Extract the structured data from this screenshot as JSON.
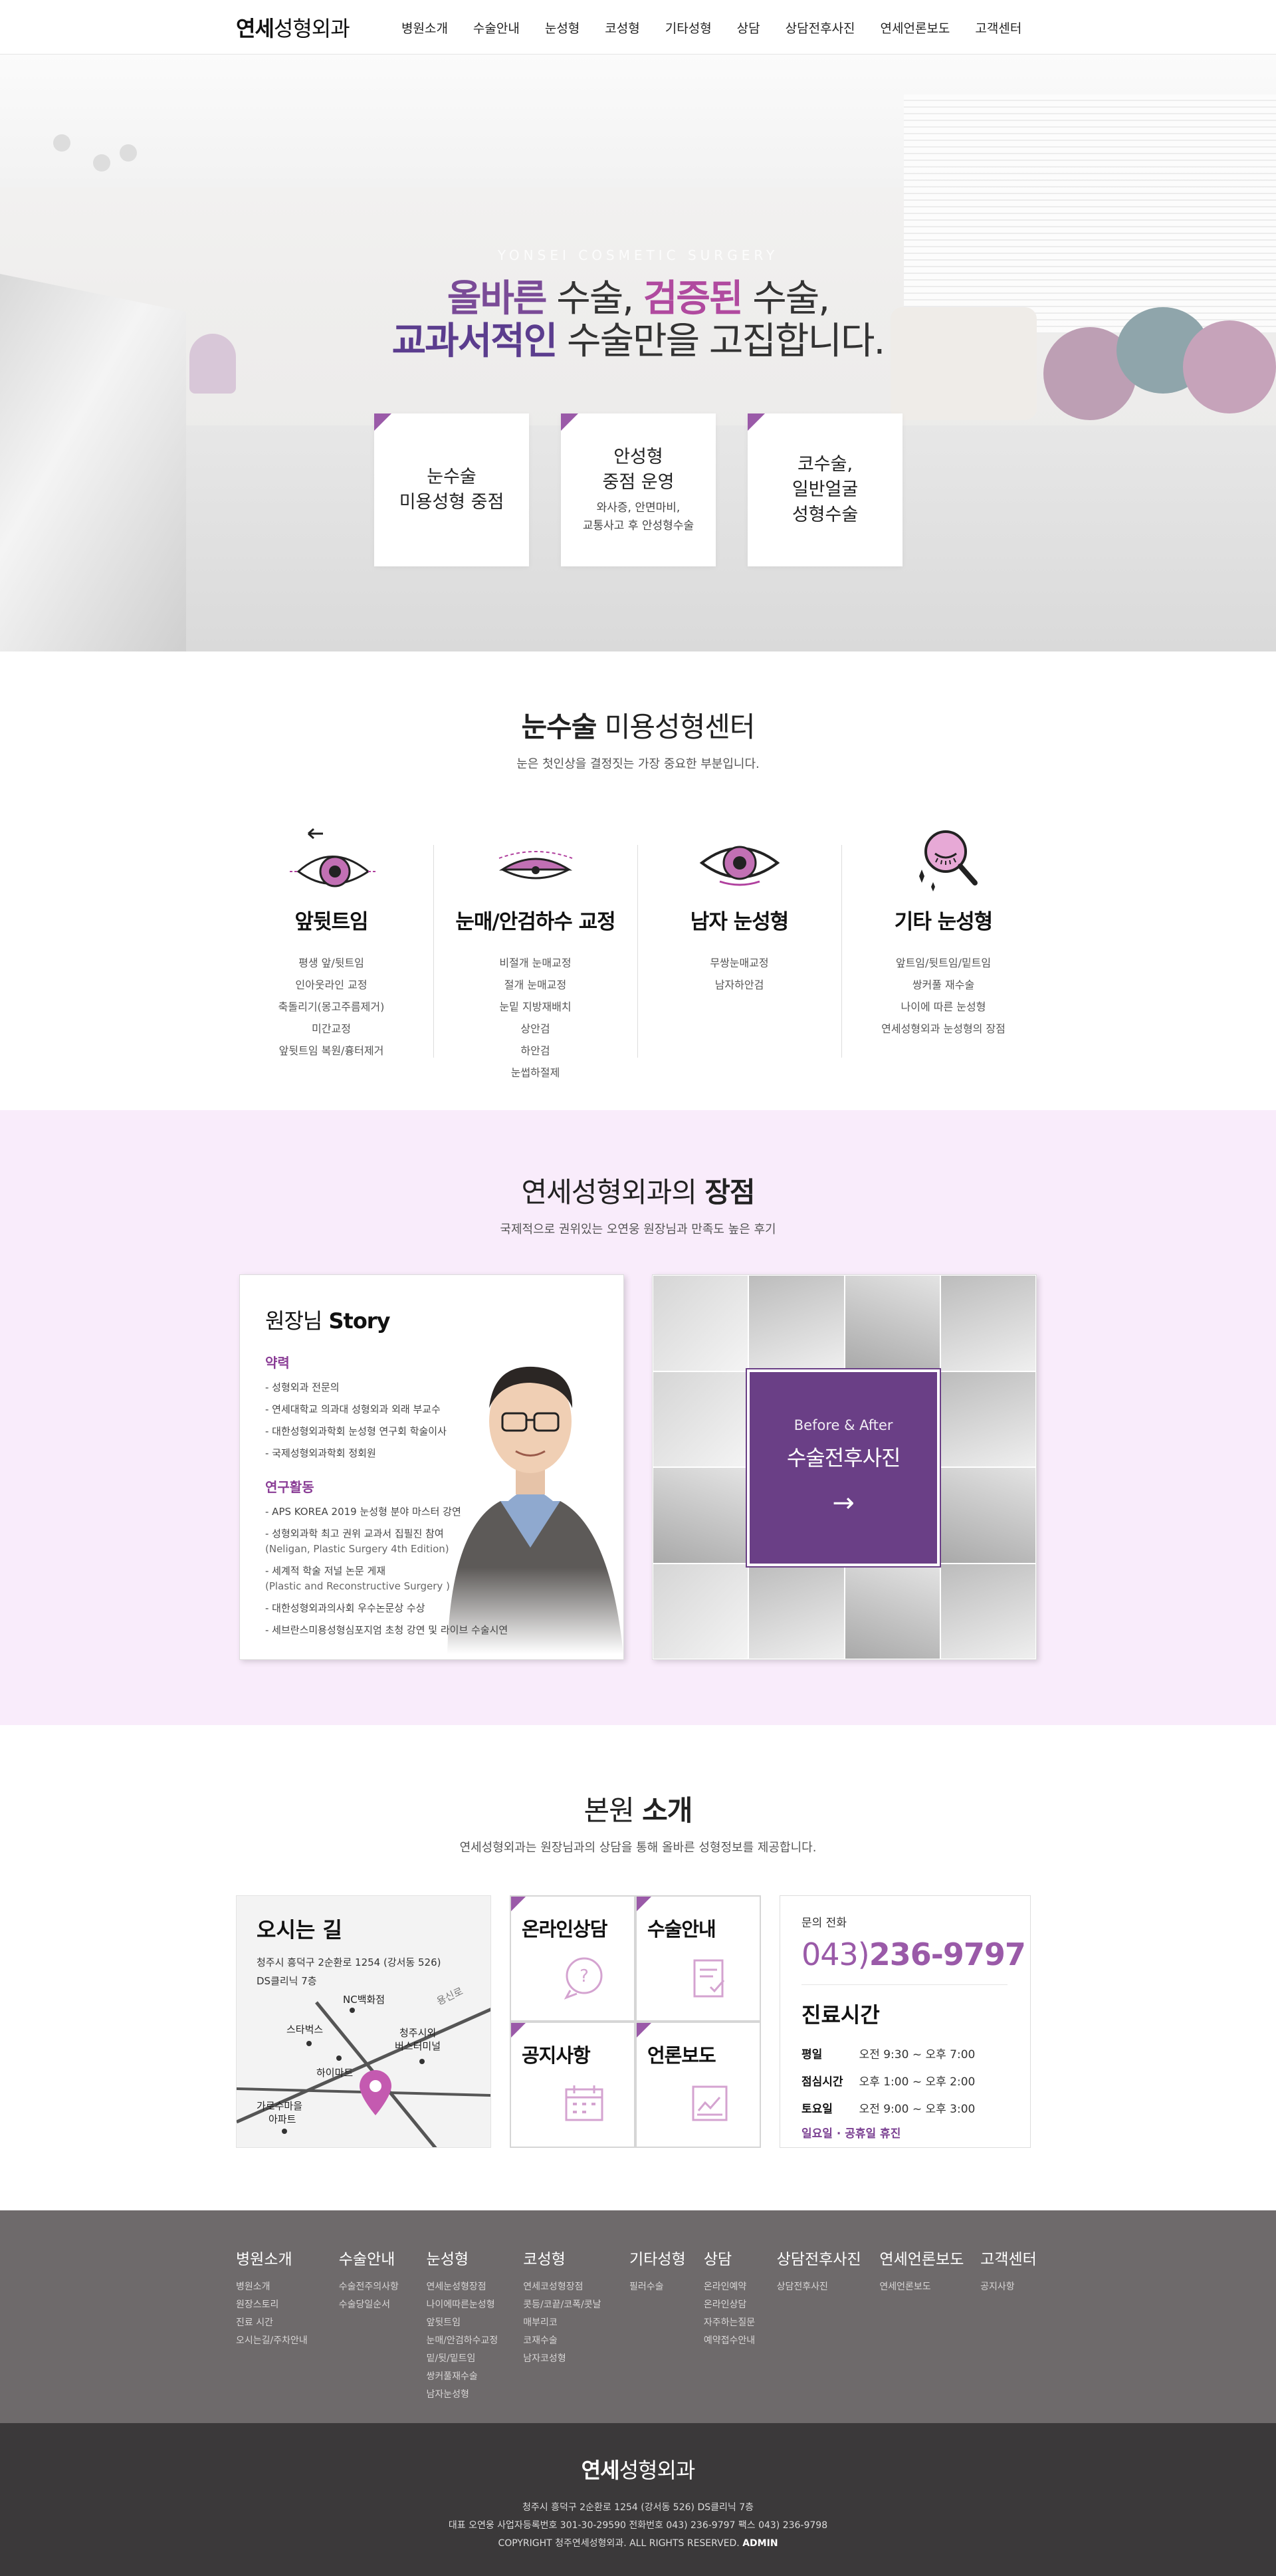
{
  "header": {
    "logo_bold": "연세",
    "logo_rest": "성형외과",
    "nav": [
      "병원소개",
      "수술안내",
      "눈성형",
      "코성형",
      "기타성형",
      "상담",
      "상담전후사진",
      "연세언론보도",
      "고객센터"
    ]
  },
  "hero": {
    "en": "YONSEI COSMETIC SURGERY",
    "line1_a": "올바른",
    "line1_b": " 수술, ",
    "line1_c": "검증된",
    "line1_d": " 수술,",
    "line2_a": "교과서적인",
    "line2_b": " 수술만을 고집합니다.",
    "cards": [
      {
        "title1": "눈수술",
        "title2": "미용성형 중점",
        "sub1": "",
        "sub2": ""
      },
      {
        "title1": "안성형",
        "title2": "중점 운영",
        "sub1": "와사증, 안면마비,",
        "sub2": "교통사고 후 안성형수술"
      },
      {
        "title1": "코수술,",
        "title2": "일반얼굴",
        "title3": "성형수술",
        "sub1": "",
        "sub2": ""
      }
    ]
  },
  "eye": {
    "title_bold": "눈수술",
    "title_rest": " 미용성형센터",
    "subtitle": "눈은 첫인상을 결정짓는 가장 중요한 부분입니다.",
    "cols": [
      {
        "title": "앞뒷트임",
        "items": [
          "평생 앞/뒷트임",
          "인아웃라인 교정",
          "축돌리기(몽고주름제거)",
          "미간교정",
          "앞뒷트임 복원/흉터제거"
        ]
      },
      {
        "title": "눈매/안검하수 교정",
        "items": [
          "비절개 눈매교정",
          "절개 눈매교정",
          "눈밑 지방재배치",
          "상안검",
          "하안검",
          "눈썹하절제"
        ]
      },
      {
        "title": "남자 눈성형",
        "items": [
          "무쌍눈매교정",
          "남자하안검"
        ]
      },
      {
        "title": "기타 눈성형",
        "items": [
          "앞트임/뒷트임/밑트임",
          "쌍커풀 재수술",
          "나이에 따른 눈성형",
          "연세성형외과 눈성형의 장점"
        ]
      }
    ]
  },
  "merit": {
    "title_rest": "연세성형외과의 ",
    "title_bold": "장점",
    "subtitle": "국제적으로 권위있는 오연웅 원장님과 만족도 높은 후기",
    "story": {
      "title_a": "원장님",
      "title_b": " Story",
      "career_label": "약력",
      "career": [
        "- 성형외과 전문의",
        "- 연세대학교 의과대 성형외과 외래 부교수",
        "- 대한성형외과학회 눈성형 연구회 학술이사",
        "- 국제성형외과학회 정회원"
      ],
      "research_label": "연구활동",
      "research": [
        {
          "a": "- APS KOREA 2019 눈성형 분야 마스터 강연",
          "b": ""
        },
        {
          "a": "- 성형외과학 최고 권위 교과서 집필진 참여",
          "b": "(Neligan, Plastic Surgery 4th Edition)"
        },
        {
          "a": "- 세계적 학술 저널 논문 게재",
          "b": "(Plastic and Reconstructive Surgery )"
        },
        {
          "a": "- 대한성형외과의사회 우수논문상 수상",
          "b": ""
        },
        {
          "a": "- 세브란스미용성형심포지엄 초청 강연 및 라이브 수술시연",
          "b": ""
        }
      ]
    },
    "ba": {
      "en": "Before & After",
      "ko": "수술전후사진",
      "arrow": "→"
    }
  },
  "intro": {
    "title_rest": "본원 ",
    "title_bold": "소개",
    "subtitle": "연세성형외과는 원장님과의 상담을 통해 올바른 성형정보를 제공합니다.",
    "map": {
      "title": "오시는 길",
      "addr1": "청주시 흥덕구 2순환로 1254 (강서동 526)",
      "addr2": "DS클리닉 7층",
      "labels": [
        "NC백화점",
        "용신로",
        "스타벅스",
        "청주시외",
        "버스터미널",
        "하이마트",
        "가로수마을",
        "아파트"
      ]
    },
    "quick": [
      "온라인상담",
      "수술안내",
      "공지사항",
      "언론보도"
    ],
    "contact": {
      "label": "문의 전화",
      "area": "043)",
      "num": "236-9797",
      "hours_title": "진료시간",
      "rows": [
        {
          "k": "평일",
          "v": "오전 9:30 ~ 오후 7:00"
        },
        {
          "k": "점심시간",
          "v": "오후 1:00 ~ 오후 2:00"
        },
        {
          "k": "토요일",
          "v": "오전 9:00 ~ 오후 3:00"
        }
      ],
      "holiday": "일요일 · 공휴일 휴진"
    }
  },
  "sitemap": [
    {
      "title": "병원소개",
      "items": [
        "병원소개",
        "원장스토리",
        "진료 시간",
        "오시는길/주차안내"
      ]
    },
    {
      "title": "수술안내",
      "items": [
        "수술전주의사항",
        "수술당일순서"
      ]
    },
    {
      "title": "눈성형",
      "items": [
        "연세눈성형장점",
        "나이에따른눈성형",
        "앞뒷트임",
        "눈매/안검하수교정",
        "밑/뒷/밑트임",
        "쌍커풀재수술",
        "남자눈성형"
      ]
    },
    {
      "title": "코성형",
      "items": [
        "연세코성형장점",
        "콧등/코끝/코폭/콧날",
        "매부리코",
        "코재수술",
        "남자코성형"
      ]
    },
    {
      "title": "기타성형",
      "items": [
        "필러수술"
      ]
    },
    {
      "title": "상담",
      "items": [
        "온라인예약",
        "온라인상담",
        "자주하는질문",
        "예약접수안내"
      ]
    },
    {
      "title": "상담전후사진",
      "items": [
        "상담전후사진"
      ]
    },
    {
      "title": "연세언론보도",
      "items": [
        "연세언론보도"
      ]
    },
    {
      "title": "고객센터",
      "items": [
        "공지사항"
      ]
    }
  ],
  "footer": {
    "logo_bold": "연세",
    "logo_rest": "성형외과",
    "line1": "청주시 흥덕구 2순환로 1254 (강서동 526) DS클리닉 7층",
    "line2": "대표 오연웅  사업자등록번호 301-30-29590  전화번호 043) 236-9797  팩스 043) 236-9798",
    "line3": "COPYRIGHT 청주연세성형외과. ALL RIGHTS RESERVED.",
    "admin": "ADMIN"
  },
  "colors": {
    "accent": "#9a5aa8",
    "deep": "#6a3f86",
    "pink_bg": "#f9ecfb",
    "sitemap_bg": "#6e6a6b",
    "footer_bg": "#3b393a"
  }
}
